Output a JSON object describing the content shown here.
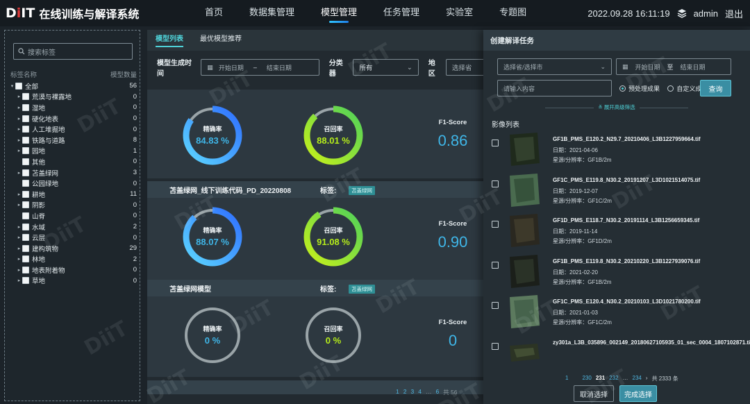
{
  "app": {
    "logo_d": "D",
    "logo_i": "i",
    "logo_it": "IT",
    "title": "在线训练与解译系统"
  },
  "nav": [
    {
      "label": "首页"
    },
    {
      "label": "数据集管理"
    },
    {
      "label": "模型管理",
      "active": true
    },
    {
      "label": "任务管理"
    },
    {
      "label": "实验室"
    },
    {
      "label": "专题图"
    }
  ],
  "header": {
    "datetime": "2022.09.28 16:11:19",
    "user": "admin",
    "logout": "退出"
  },
  "sidebar": {
    "search_placeholder": "搜索标签",
    "col_name": "标签名称",
    "col_count": "模型数量",
    "items": [
      {
        "label": "全部",
        "count": "56",
        "level": 0,
        "arrow": "▾"
      },
      {
        "label": "荒漠与裸露地",
        "count": "0",
        "level": 1,
        "arrow": "▸"
      },
      {
        "label": "湿地",
        "count": "0",
        "level": 1,
        "arrow": "▸"
      },
      {
        "label": "硬化地表",
        "count": "0",
        "level": 1,
        "arrow": "▸"
      },
      {
        "label": "人工堆掘地",
        "count": "0",
        "level": 1,
        "arrow": "▸"
      },
      {
        "label": "铁路与道路",
        "count": "8",
        "level": 1,
        "arrow": "▸"
      },
      {
        "label": "园地",
        "count": "1",
        "level": 1,
        "arrow": "▸"
      },
      {
        "label": "其他",
        "count": "0",
        "level": 1,
        "arrow": ""
      },
      {
        "label": "苫盖绿网",
        "count": "3",
        "level": 1,
        "arrow": "▸"
      },
      {
        "label": "公园绿地",
        "count": "0",
        "level": 1,
        "arrow": ""
      },
      {
        "label": "耕地",
        "count": "11",
        "level": 1,
        "arrow": "▸"
      },
      {
        "label": "阴影",
        "count": "0",
        "level": 1,
        "arrow": "▸"
      },
      {
        "label": "山脊",
        "count": "0",
        "level": 1,
        "arrow": ""
      },
      {
        "label": "水域",
        "count": "2",
        "level": 1,
        "arrow": "▸"
      },
      {
        "label": "云层",
        "count": "0",
        "level": 1,
        "arrow": "▸"
      },
      {
        "label": "建构筑物",
        "count": "29",
        "level": 1,
        "arrow": "▸"
      },
      {
        "label": "林地",
        "count": "2",
        "level": 1,
        "arrow": "▸"
      },
      {
        "label": "地表附着物",
        "count": "0",
        "level": 1,
        "arrow": "▸"
      },
      {
        "label": "草地",
        "count": "0",
        "level": 1,
        "arrow": "▸"
      }
    ]
  },
  "main": {
    "tabs": [
      {
        "label": "模型列表",
        "active": true
      },
      {
        "label": "最优模型推荐"
      }
    ],
    "filter": {
      "time_label": "模型生成时间",
      "start_placeholder": "开始日期",
      "sep": "–",
      "end_placeholder": "结束日期",
      "classifier_label": "分类器",
      "classifier_value": "所有",
      "region_label": "地区",
      "region_placeholder": "选择省"
    },
    "cards": [
      {
        "name": "苫盖绿网_线下训练代码_PD_20220808",
        "tag_label": "标签:",
        "tag": "苫盖绿网",
        "precision_label": "精确率",
        "precision": "88.07 %",
        "precision_frac": 0.8807,
        "recall_label": "召回率",
        "recall": "91.08 %",
        "recall_frac": 0.9108,
        "f1_label": "F1-Score",
        "f1": "0.90"
      },
      {
        "name": "苫盖绿网模型",
        "tag_label": "标签:",
        "tag": "苫盖绿网",
        "precision_label": "精确率",
        "precision": "0 %",
        "precision_frac": 0,
        "recall_label": "召回率",
        "recall": "0 %",
        "recall_frac": 0,
        "f1_label": "F1-Score",
        "f1": "0"
      }
    ],
    "top_card": {
      "precision_label": "精确率",
      "precision": "84.83 %",
      "precision_frac": 0.8483,
      "recall_label": "召回率",
      "recall": "88.01 %",
      "recall_frac": 0.8801,
      "f1_label": "F1-Score",
      "f1": "0.86"
    },
    "pagination": {
      "pages": [
        "1",
        "2",
        "3",
        "4",
        "…",
        "6"
      ],
      "total": "共 56"
    }
  },
  "panel": {
    "title": "创建解译任务",
    "province_placeholder": "选择省/选择市",
    "start_placeholder": "开始日期",
    "to": "至",
    "end_placeholder": "结束日期",
    "keyword_placeholder": "请输入内容",
    "radio_1": "预处理成果",
    "radio_2": "自定义成果",
    "query": "查询",
    "expand": "展开高级筛选",
    "list_title": "影像列表",
    "images": [
      {
        "name": "GF1B_PMS_E120.2_N29.7_20210406_L3B1227959664.tif",
        "date": "日期：2021-04-06",
        "source": "星源/分辨率：GF1B/2m"
      },
      {
        "name": "GF1C_PMS_E119.8_N30.2_20191207_L3D1021514075.tif",
        "date": "日期：2019-12-07",
        "source": "星源/分辨率：GF1C/2m"
      },
      {
        "name": "GF1D_PMS_E118.7_N30.2_20191114_L3B1256659345.tif",
        "date": "日期：2019-11-14",
        "source": "星源/分辨率：GF1D/2m"
      },
      {
        "name": "GF1B_PMS_E119.8_N30.2_20210220_L3B1227939076.tif",
        "date": "日期：2021-02-20",
        "source": "星源/分辨率：GF1B/2m"
      },
      {
        "name": "GF1C_PMS_E120.4_N30.2_20210103_L3D1021780200.tif",
        "date": "日期：2021-01-03",
        "source": "星源/分辨率：GF1C/2m"
      },
      {
        "name": "zy301a_L3B_035896_002149_20180627105935_01_sec_0004_1807102871.tif",
        "date": "",
        "source": ""
      }
    ],
    "pages": {
      "p1": "1",
      "p230": "230",
      "p231": "231",
      "p232": "232",
      "ellipsis": "…",
      "p234": "234",
      "next": "›",
      "total": "共 2333 条"
    },
    "cancel": "取消选择",
    "done": "完成选择"
  },
  "watermark": "DiiT",
  "colors": {
    "accent": "#4fd2d8",
    "blue_ring": "#2f8fff",
    "green_ring": "#9be01a",
    "ring_track": "#8a9599"
  }
}
